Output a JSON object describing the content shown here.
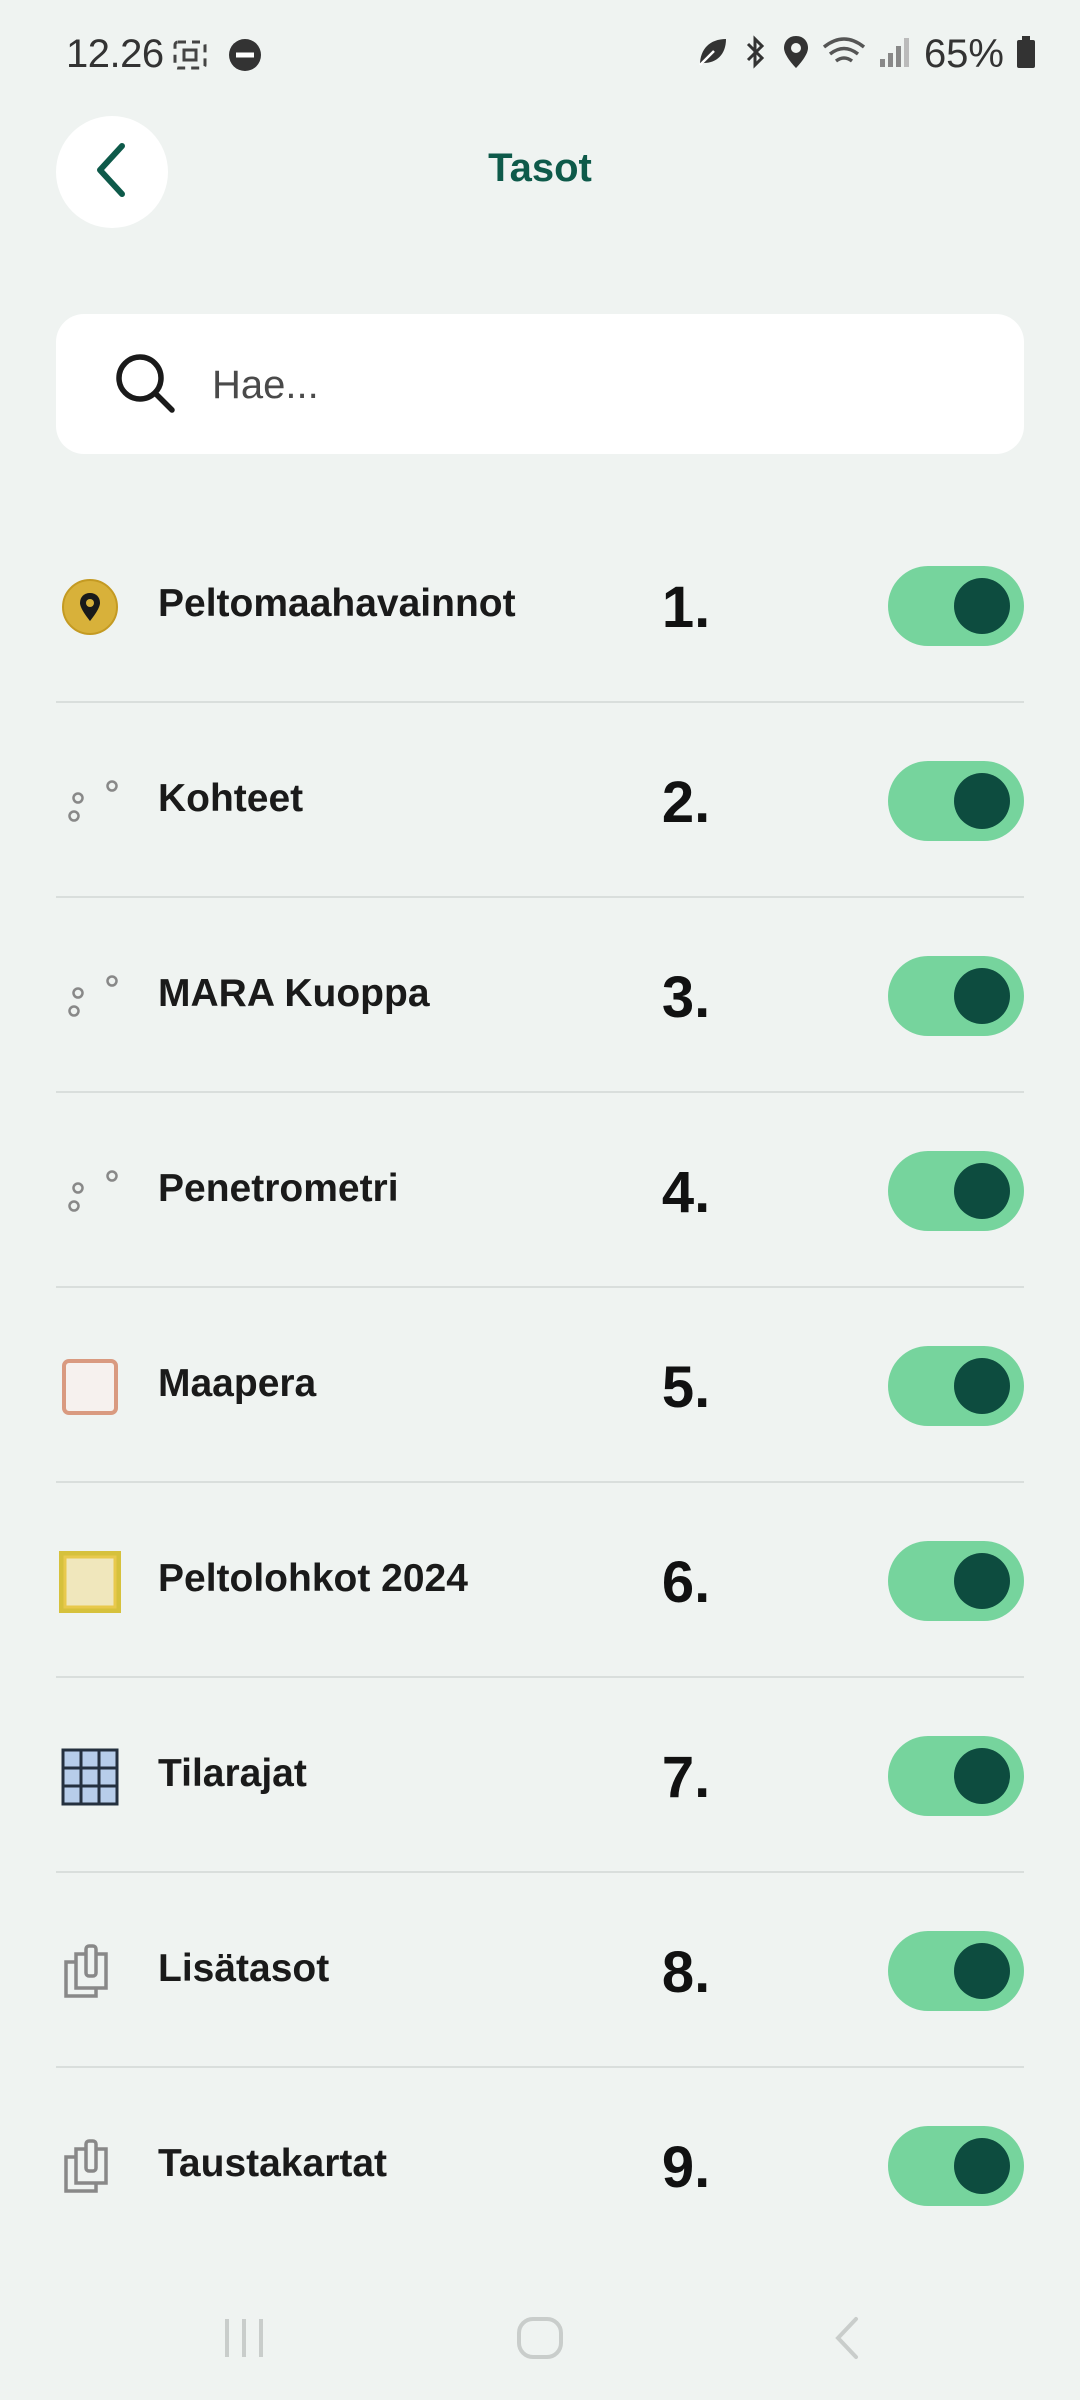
{
  "status_bar": {
    "time": "12.26",
    "battery_text": "65%"
  },
  "header": {
    "title": "Tasot",
    "back_icon": "chevron-left-icon"
  },
  "search": {
    "placeholder": "Hae...",
    "value": ""
  },
  "layers": [
    {
      "label": "Peltomaahavainnot",
      "number": "1.",
      "icon": "location-pin-icon",
      "enabled": true
    },
    {
      "label": "Kohteet",
      "number": "2.",
      "icon": "point-layer-icon",
      "enabled": true
    },
    {
      "label": "MARA Kuoppa",
      "number": "3.",
      "icon": "point-layer-icon",
      "enabled": true
    },
    {
      "label": "Penetrometri",
      "number": "4.",
      "icon": "point-layer-icon",
      "enabled": true
    },
    {
      "label": "Maapera",
      "number": "5.",
      "icon": "polygon-outline-icon",
      "enabled": true
    },
    {
      "label": "Peltolohkot 2024",
      "number": "6.",
      "icon": "polygon-fill-icon",
      "enabled": true
    },
    {
      "label": "Tilarajat",
      "number": "7.",
      "icon": "grid-icon",
      "enabled": true
    },
    {
      "label": "Lisätasot",
      "number": "8.",
      "icon": "layers-icon",
      "enabled": true
    },
    {
      "label": "Taustakartat",
      "number": "9.",
      "icon": "layers-icon",
      "enabled": true
    }
  ],
  "colors": {
    "background": "#eff3f1",
    "accent_dark": "#0e5a4a",
    "toggle_track": "#76d49d",
    "toggle_knob": "#0d4c3f"
  }
}
